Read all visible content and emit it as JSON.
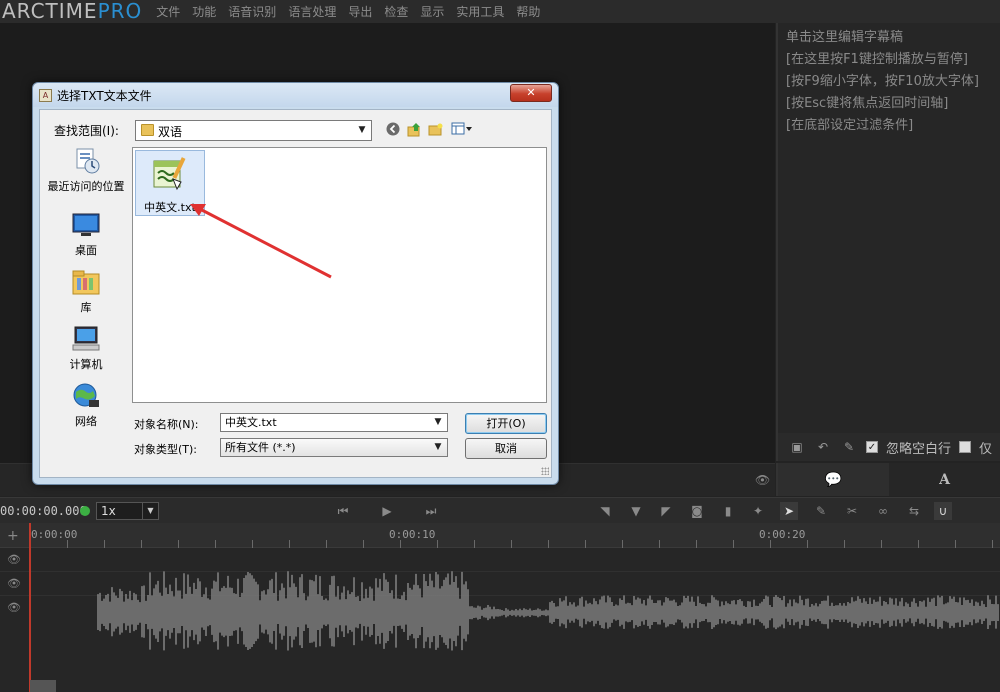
{
  "app": {
    "logo_main": "ARCTIME",
    "logo_suffix": "PRO",
    "menu": [
      "文件",
      "功能",
      "语音识别",
      "语言处理",
      "导出",
      "检查",
      "显示",
      "实用工具",
      "帮助"
    ]
  },
  "right_panel": {
    "hints": [
      "单击这里编辑字幕稿",
      "[在这里按F1键控制播放与暂停]",
      "[按F9缩小字体，按F10放大字体]",
      "[按Esc键将焦点返回时间轴]",
      "[在底部设定过滤条件]"
    ],
    "ignore_blank_label": "忽略空白行",
    "only_label": "仅",
    "tab_text_icon": "A"
  },
  "timeline": {
    "timecode": "00:00:00.000",
    "speed": "1x",
    "ruler_labels": [
      "0:00:00",
      "0:00:10",
      "0:00:20"
    ]
  },
  "dialog": {
    "title": "选择TXT文本文件",
    "close_label": "✕",
    "look_in_label": "查找范围(I):",
    "look_in_value": "双语",
    "places": [
      {
        "label": "最近访问的位置",
        "icon": "recent-places-icon"
      },
      {
        "label": "桌面",
        "icon": "desktop-icon"
      },
      {
        "label": "库",
        "icon": "library-icon"
      },
      {
        "label": "计算机",
        "icon": "computer-icon"
      },
      {
        "label": "网络",
        "icon": "network-icon"
      }
    ],
    "file": {
      "name": "中英文.txt",
      "icon": "notepad-text-file-icon"
    },
    "filename_label": "对象名称(N):",
    "filename_value": "中英文.txt",
    "filetype_label": "对象类型(T):",
    "filetype_value": "所有文件 (*.*)",
    "open_button": "打开(O)",
    "cancel_button": "取消"
  },
  "colors": {
    "accent": "#2a8fd1",
    "annotation_arrow": "#e03131",
    "playhead": "#c0392b",
    "status_dot": "#3cb043"
  }
}
